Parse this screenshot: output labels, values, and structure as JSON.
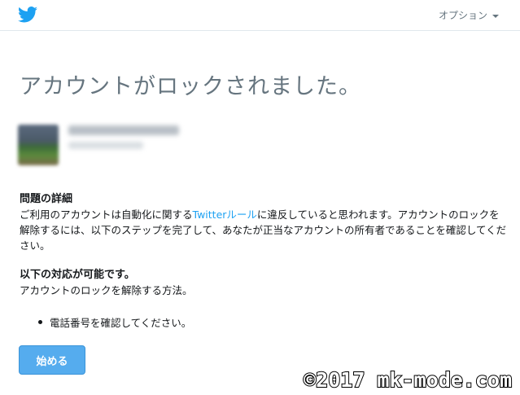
{
  "header": {
    "logo": "twitter-bird-icon",
    "options_label": "オプション",
    "brand_color": "#1da1f2"
  },
  "main": {
    "title": "アカウントがロックされました。",
    "profile": {
      "name": "",
      "handle": ""
    },
    "problem": {
      "heading": "問題の詳細",
      "text_before_link": "ご利用のアカウントは自動化に関する",
      "link_text": "Twitterルール",
      "text_after_link": "に違反していると思われます。アカウントのロックを解除するには、以下のステップを完了して、あなたが正当なアカウントの所有者であることを確認してください。"
    },
    "actions": {
      "heading": "以下の対応が可能です。",
      "text": "アカウントのロックを解除する方法。",
      "steps": [
        "電話番号を確認してください。"
      ]
    },
    "start_button": "始める",
    "button_color": "#55acee"
  },
  "watermark": "©2017 mk-mode.com"
}
